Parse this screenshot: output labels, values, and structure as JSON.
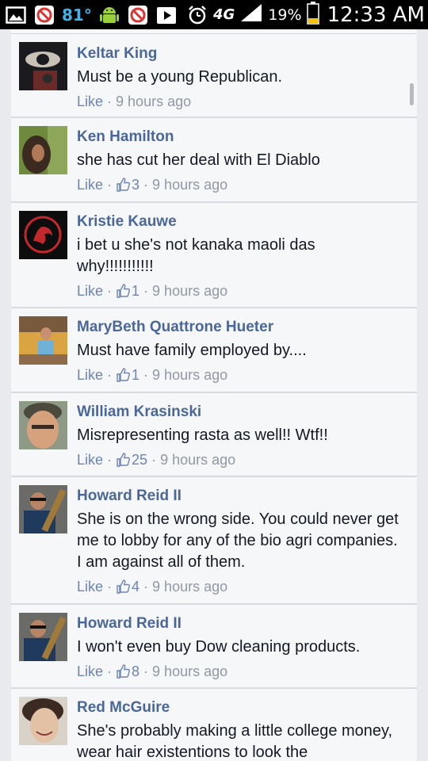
{
  "status_bar": {
    "temperature": "81°",
    "network": "4G",
    "battery": "19%",
    "time": "12:33 AM",
    "icons": [
      "picture-icon",
      "notification-icon",
      "android-icon",
      "notification-icon",
      "play-store-icon",
      "alarm-icon",
      "signal-icon",
      "battery-icon"
    ]
  },
  "comments": [
    {
      "author": "Keltar King",
      "text": "Must be a young Republican.",
      "like_label": "Like",
      "likes": "",
      "time": "9 hours ago"
    },
    {
      "author": "Ken Hamilton",
      "text": "she has cut her deal with El Diablo",
      "like_label": "Like",
      "likes": "3",
      "time": "9 hours ago"
    },
    {
      "author": "Kristie Kauwe",
      "text": "i bet u she's not kanaka maoli das why!!!!!!!!!!!",
      "like_label": "Like",
      "likes": "1",
      "time": "9 hours ago"
    },
    {
      "author": "MaryBeth Quattrone Hueter",
      "text": "Must have family employed by....",
      "like_label": "Like",
      "likes": "1",
      "time": "9 hours ago"
    },
    {
      "author": "William Krasinski",
      "text": "Misrepresenting rasta as well!! Wtf!!",
      "like_label": "Like",
      "likes": "25",
      "time": "9 hours ago"
    },
    {
      "author": "Howard Reid II",
      "text": "She is on the wrong side. You could never get me to lobby for any of the bio agri companies. I am against all of them.",
      "like_label": "Like",
      "likes": "4",
      "time": "9 hours ago"
    },
    {
      "author": "Howard Reid II",
      "text": "I won't even buy Dow cleaning products.",
      "like_label": "Like",
      "likes": "8",
      "time": "9 hours ago"
    },
    {
      "author": "Red McGuire",
      "text": "She's probably making a little college money, wear hair existentions to look the",
      "like_label": "Like",
      "likes": "",
      "time": ""
    }
  ]
}
